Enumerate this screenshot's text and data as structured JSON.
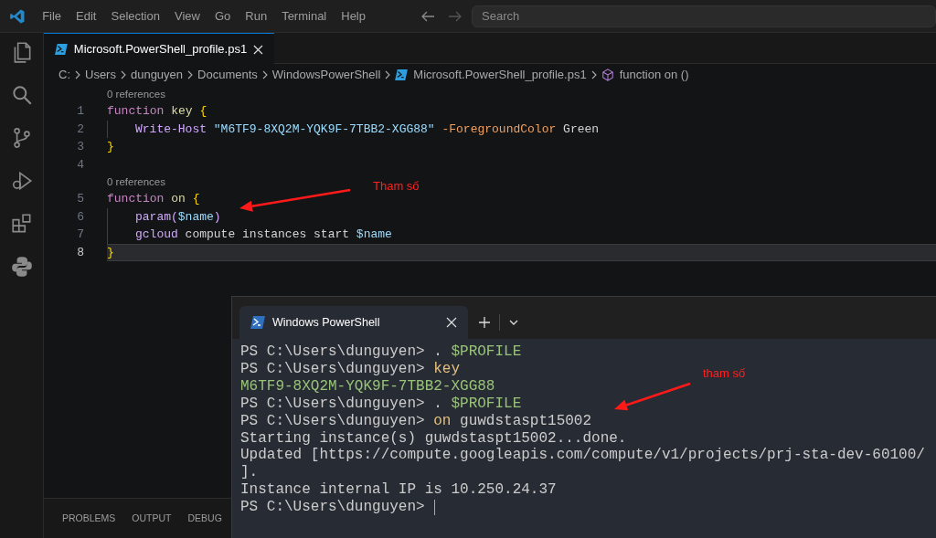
{
  "menu": [
    "File",
    "Edit",
    "Selection",
    "View",
    "Go",
    "Run",
    "Terminal",
    "Help"
  ],
  "search": {
    "placeholder": "Search"
  },
  "editor_tabs": [
    {
      "label": "Microsoft.PowerShell_profile.ps1",
      "selected": true
    }
  ],
  "breadcrumbs": [
    {
      "label": "C:",
      "kind": "folder"
    },
    {
      "label": "Users",
      "kind": "folder"
    },
    {
      "label": "dunguyen",
      "kind": "folder"
    },
    {
      "label": "Documents",
      "kind": "folder"
    },
    {
      "label": "WindowsPowerShell",
      "kind": "folder"
    },
    {
      "label": "Microsoft.PowerShell_profile.ps1",
      "kind": "file"
    },
    {
      "label": "function on ()",
      "kind": "symbol"
    }
  ],
  "code_lines": [
    {
      "number": "1",
      "codelens": "0 references",
      "current": false,
      "tokens": [
        {
          "kind": "keyword",
          "text": "function"
        },
        {
          "kind": "name",
          "text": " key"
        },
        {
          "kind": "brace",
          "text": " {"
        }
      ]
    },
    {
      "number": "2",
      "current": false,
      "indent": true,
      "tokens": [
        {
          "kind": "command",
          "text": "Write-Host"
        },
        {
          "kind": "string",
          "text": " \"M6TF9-8XQ2M-YQK9F-7TBB2-XGG88\""
        },
        {
          "kind": "option",
          "text": " -ForegroundColor"
        },
        {
          "kind": "plain",
          "text": " Green"
        }
      ]
    },
    {
      "number": "3",
      "current": false,
      "tokens": [
        {
          "kind": "brace",
          "text": "}"
        }
      ]
    },
    {
      "number": "4",
      "current": false
    },
    {
      "number": "5",
      "codelens": "0 references",
      "current": false,
      "tokens": [
        {
          "kind": "keyword",
          "text": "function"
        },
        {
          "kind": "name",
          "text": " on"
        },
        {
          "kind": "brace",
          "text": " {"
        }
      ]
    },
    {
      "number": "6",
      "current": false,
      "indent": true,
      "tokens": [
        {
          "kind": "command",
          "text": "param("
        },
        {
          "kind": "variable",
          "text": "$name"
        },
        {
          "kind": "command",
          "text": ")"
        }
      ]
    },
    {
      "number": "7",
      "current": false,
      "indent": true,
      "tokens": [
        {
          "kind": "command",
          "text": "gcloud"
        },
        {
          "kind": "plain",
          "text": " compute instances start "
        },
        {
          "kind": "variable",
          "text": "$name"
        }
      ]
    },
    {
      "number": "8",
      "current": true,
      "tokens": [
        {
          "kind": "brace",
          "text": "}"
        }
      ]
    }
  ],
  "panel_tabs": [
    {
      "label": "PROBLEMS",
      "selected": false
    },
    {
      "label": "OUTPUT",
      "selected": false
    },
    {
      "label": "DEBUG",
      "selected": false
    }
  ],
  "terminal": {
    "tab": "Windows PowerShell",
    "lines": [
      {
        "tokens": [
          {
            "kind": "plain",
            "text": "PS C:\\Users\\dunguyen> "
          },
          {
            "kind": "plain",
            "text": ". "
          },
          {
            "kind": "variable",
            "text": "$PROFILE"
          }
        ]
      },
      {
        "tokens": [
          {
            "kind": "plain",
            "text": "PS C:\\Users\\dunguyen> "
          },
          {
            "kind": "command",
            "text": "key"
          }
        ]
      },
      {
        "tokens": [
          {
            "kind": "variable",
            "text": "M6TF9-8XQ2M-YQK9F-7TBB2-XGG88"
          }
        ]
      },
      {
        "tokens": [
          {
            "kind": "plain",
            "text": "PS C:\\Users\\dunguyen> "
          },
          {
            "kind": "plain",
            "text": ". "
          },
          {
            "kind": "variable",
            "text": "$PROFILE"
          }
        ]
      },
      {
        "tokens": [
          {
            "kind": "plain",
            "text": "PS C:\\Users\\dunguyen> "
          },
          {
            "kind": "command",
            "text": "on"
          },
          {
            "kind": "plain",
            "text": " guwdstaspt15002"
          }
        ]
      },
      {
        "tokens": [
          {
            "kind": "plain",
            "text": "Starting instance(s) guwdstaspt15002...done."
          }
        ]
      },
      {
        "tokens": [
          {
            "kind": "plain",
            "text": "Updated [https://compute.googleapis.com/compute/v1/projects/prj-sta-dev-60100/"
          }
        ]
      },
      {
        "tokens": [
          {
            "kind": "plain",
            "text": "]."
          }
        ]
      },
      {
        "tokens": [
          {
            "kind": "plain",
            "text": "Instance internal IP is 10.250.24.37"
          }
        ]
      },
      {
        "cursor": true,
        "tokens": [
          {
            "kind": "plain",
            "text": "PS C:\\Users\\dunguyen> "
          }
        ]
      }
    ]
  },
  "annotations": [
    {
      "text": "Tham số"
    },
    {
      "text": "tham số"
    }
  ]
}
